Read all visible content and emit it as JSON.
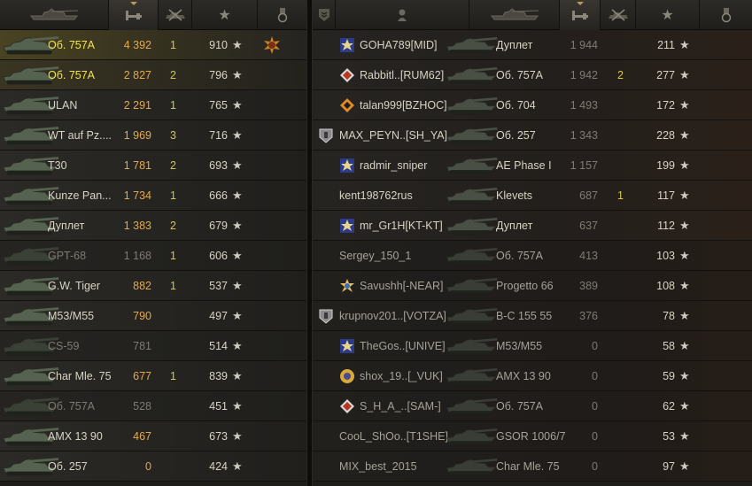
{
  "left_team": {
    "rows": [
      {
        "tank": "Об. 757А",
        "damage": "4 392",
        "kills": "1",
        "xp": "910",
        "medal": true,
        "style": "selected",
        "name_color": "gold",
        "dmg_color": "orange"
      },
      {
        "tank": "Об. 757А",
        "damage": "2 827",
        "kills": "2",
        "xp": "796",
        "medal": false,
        "style": "hl",
        "name_color": "gold",
        "dmg_color": "orange"
      },
      {
        "tank": "ULAN",
        "damage": "2 291",
        "kills": "1",
        "xp": "765",
        "medal": false,
        "style": "",
        "name_color": "",
        "dmg_color": "orange"
      },
      {
        "tank": "WT auf Pz....",
        "damage": "1 969",
        "kills": "3",
        "xp": "716",
        "medal": false,
        "style": "",
        "name_color": "",
        "dmg_color": "orange"
      },
      {
        "tank": "T30",
        "damage": "1 781",
        "kills": "2",
        "xp": "693",
        "medal": false,
        "style": "",
        "name_color": "",
        "dmg_color": "orange"
      },
      {
        "tank": "Kunze Pan...",
        "damage": "1 734",
        "kills": "1",
        "xp": "666",
        "medal": false,
        "style": "",
        "name_color": "",
        "dmg_color": "orange"
      },
      {
        "tank": "Дуплет",
        "damage": "1 383",
        "kills": "2",
        "xp": "679",
        "medal": false,
        "style": "",
        "name_color": "",
        "dmg_color": "orange"
      },
      {
        "tank": "GPT-68",
        "damage": "1 168",
        "kills": "1",
        "xp": "606",
        "medal": false,
        "style": "dim",
        "name_color": "grey",
        "dmg_color": "grey"
      },
      {
        "tank": "G.W. Tiger",
        "damage": "882",
        "kills": "1",
        "xp": "537",
        "medal": false,
        "style": "",
        "name_color": "",
        "dmg_color": "orange"
      },
      {
        "tank": "M53/M55",
        "damage": "790",
        "kills": "",
        "xp": "497",
        "medal": false,
        "style": "",
        "name_color": "",
        "dmg_color": "orange"
      },
      {
        "tank": "CS-59",
        "damage": "781",
        "kills": "",
        "xp": "514",
        "medal": false,
        "style": "dim",
        "name_color": "grey",
        "dmg_color": "grey"
      },
      {
        "tank": "Char Mle. 75",
        "damage": "677",
        "kills": "1",
        "xp": "839",
        "medal": false,
        "style": "",
        "name_color": "",
        "dmg_color": "orange"
      },
      {
        "tank": "Об. 757А",
        "damage": "528",
        "kills": "",
        "xp": "451",
        "medal": false,
        "style": "dim",
        "name_color": "grey",
        "dmg_color": "grey"
      },
      {
        "tank": "AMX 13 90",
        "damage": "467",
        "kills": "",
        "xp": "673",
        "medal": false,
        "style": "",
        "name_color": "",
        "dmg_color": "orange"
      },
      {
        "tank": "Об. 257",
        "damage": "0",
        "kills": "",
        "xp": "424",
        "medal": false,
        "style": "",
        "name_color": "",
        "dmg_color": "orange"
      }
    ]
  },
  "right_team": {
    "rows": [
      {
        "player": "GOHA789[MID]",
        "badge": "star",
        "tank": "Дуплет",
        "damage": "1 944",
        "kills": "",
        "xp": "211",
        "dim": false
      },
      {
        "player": "Rabbitl..[RUM62]",
        "badge": "diamond",
        "tank": "Об. 757А",
        "damage": "1 942",
        "kills": "2",
        "xp": "277",
        "dim": false
      },
      {
        "player": "talan999[BZHOC]",
        "badge": "diamond-orange",
        "tank": "Об. 704",
        "damage": "1 493",
        "kills": "",
        "xp": "172",
        "dim": false
      },
      {
        "player": "MAX_PEYN..[SH_YA]",
        "badge": "shield",
        "tank": "Об. 257",
        "damage": "1 343",
        "kills": "",
        "xp": "228",
        "dim": false
      },
      {
        "player": "radmir_sniper",
        "badge": "star",
        "tank": "AE Phase I",
        "damage": "1 157",
        "kills": "",
        "xp": "199",
        "dim": false
      },
      {
        "player": "kent198762rus",
        "badge": "",
        "tank": "Klevets",
        "damage": "687",
        "kills": "1",
        "xp": "117",
        "dim": false
      },
      {
        "player": "mr_Gr1H[KT-KT]",
        "badge": "star",
        "tank": "Дуплет",
        "damage": "637",
        "kills": "",
        "xp": "112",
        "dim": false
      },
      {
        "player": "Sergey_150_1",
        "badge": "",
        "tank": "Об. 757А",
        "damage": "413",
        "kills": "",
        "xp": "103",
        "dim": true
      },
      {
        "player": "Savushh[-NEAR]",
        "badge": "starburst",
        "tank": "Progetto 66",
        "damage": "389",
        "kills": "",
        "xp": "108",
        "dim": true
      },
      {
        "player": "krupnov201..[VOTZA]",
        "badge": "shield",
        "tank": "B-C 155 55",
        "damage": "376",
        "kills": "",
        "xp": "78",
        "dim": true
      },
      {
        "player": "TheGos..[UNIVE]",
        "badge": "star",
        "tank": "M53/M55",
        "damage": "0",
        "kills": "",
        "xp": "58",
        "dim": true
      },
      {
        "player": "shox_19..[_VUK]",
        "badge": "fist",
        "tank": "AMX 13 90",
        "damage": "0",
        "kills": "",
        "xp": "59",
        "dim": true
      },
      {
        "player": "S_H_A_..[SAM-]",
        "badge": "diamond",
        "tank": "Об. 757А",
        "damage": "0",
        "kills": "",
        "xp": "62",
        "dim": true
      },
      {
        "player": "CooL_ShOo..[T1SHE]",
        "badge": "",
        "tank": "GSOR 1006/7",
        "damage": "0",
        "kills": "",
        "xp": "53",
        "dim": true
      },
      {
        "player": "MIX_best_2015",
        "badge": "",
        "tank": "Char Mle. 75",
        "damage": "0",
        "kills": "",
        "xp": "97",
        "dim": true
      }
    ]
  },
  "icons": {
    "star": "★",
    "header_icons": [
      "tank-icon",
      "gun-damage-icon",
      "destroyed-tanks-icon",
      "xp-star-icon",
      "medal-icon",
      "rank-badge-icon",
      "player-icon"
    ]
  },
  "colors": {
    "gold": "#f2e44a",
    "damage_orange": "#e4a94e",
    "dim_grey": "#7f7b72",
    "kills_yellow": "#d4c84c"
  }
}
